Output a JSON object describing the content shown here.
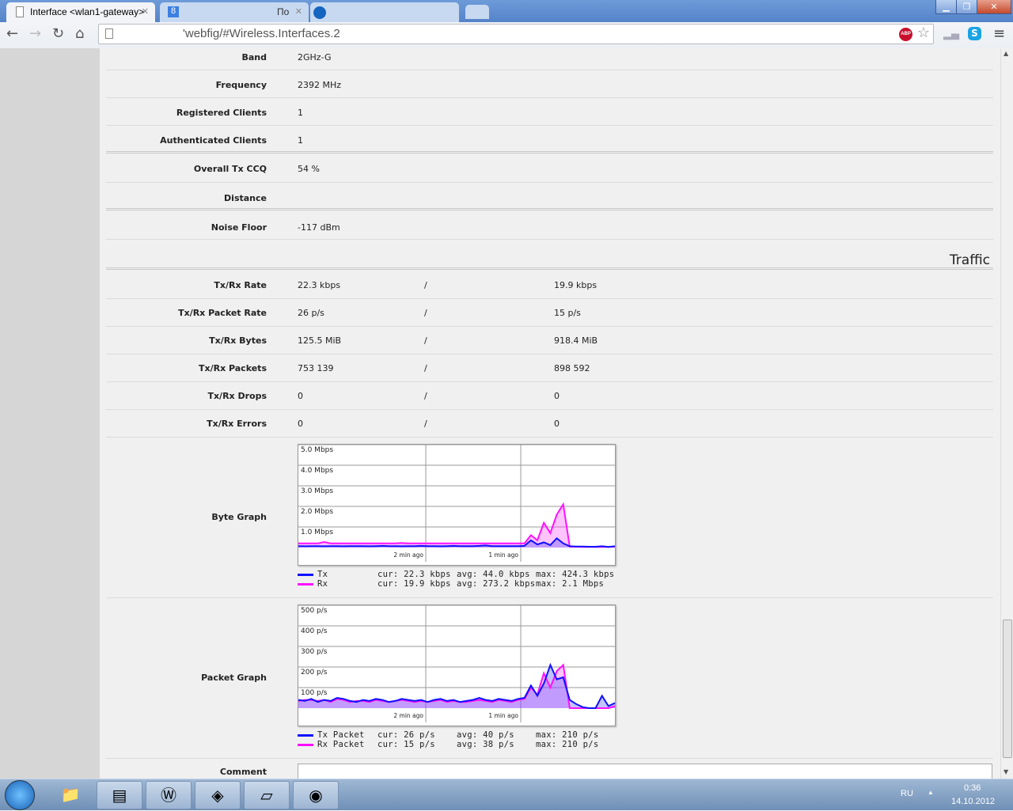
{
  "browser": {
    "tabs": [
      {
        "label": "Interface <wlan1-gateway>",
        "active": true
      },
      {
        "label": "По",
        "active": false
      },
      {
        "label": "",
        "active": false
      }
    ],
    "url": "'webfig/#Wireless.Interfaces.2",
    "abp_badge": "ABP"
  },
  "rows": [
    {
      "label": "Band",
      "value": "2GHz-G"
    },
    {
      "label": "Frequency",
      "value": "2392 MHz"
    },
    {
      "label": "Registered Clients",
      "value": "1"
    },
    {
      "label": "Authenticated Clients",
      "value": "1"
    },
    {
      "label": "Overall Tx CCQ",
      "value": "54 %"
    },
    {
      "label": "Distance",
      "value": ""
    },
    {
      "label": "Noise Floor",
      "value": "-117 dBm"
    }
  ],
  "traffic_title": "Traffic",
  "traffic_rows": [
    {
      "label": "Tx/Rx Rate",
      "tx": "22.3 kbps",
      "rx": "19.9 kbps"
    },
    {
      "label": "Tx/Rx Packet Rate",
      "tx": "26 p/s",
      "rx": "15 p/s"
    },
    {
      "label": "Tx/Rx Bytes",
      "tx": "125.5 MiB",
      "rx": "918.4 MiB"
    },
    {
      "label": "Tx/Rx Packets",
      "tx": "753 139",
      "rx": "898 592"
    },
    {
      "label": "Tx/Rx Drops",
      "tx": "0",
      "rx": "0"
    },
    {
      "label": "Tx/Rx Errors",
      "tx": "0",
      "rx": "0"
    }
  ],
  "slash": "/",
  "comment_label": "Comment",
  "chart_data": [
    {
      "type": "area",
      "title": "Byte Graph",
      "ylim": [
        0,
        5
      ],
      "yticks": [
        "1.0 Mbps",
        "2.0 Mbps",
        "3.0 Mbps",
        "4.0 Mbps",
        "5.0 Mbps"
      ],
      "xticks": [
        "2 min ago",
        "1 min ago"
      ],
      "series": [
        {
          "name": "Tx",
          "color": "#1010ff",
          "cur": "cur: 22.3 kbps",
          "avg": "avg: 44.0 kbps",
          "max": "max: 424.3 kbps",
          "values": [
            0.07,
            0.06,
            0.07,
            0.07,
            0.06,
            0.07,
            0.07,
            0.06,
            0.07,
            0.07,
            0.07,
            0.06,
            0.07,
            0.08,
            0.07,
            0.07,
            0.06,
            0.07,
            0.07,
            0.08,
            0.07,
            0.07,
            0.06,
            0.07,
            0.08,
            0.07,
            0.07,
            0.07,
            0.08,
            0.1,
            0.07,
            0.07,
            0.07,
            0.07,
            0.07,
            0.08,
            0.35,
            0.15,
            0.25,
            0.12,
            0.45,
            0.2,
            0.06,
            0.05,
            0.05,
            0.04,
            0.04,
            0.06,
            0.03,
            0.06
          ]
        },
        {
          "name": "Rx",
          "color": "#ff10ff",
          "cur": "cur: 19.9 kbps",
          "avg": "avg: 273.2 kbps",
          "max": "max: 2.1 Mbps",
          "values": [
            0.2,
            0.2,
            0.2,
            0.2,
            0.27,
            0.2,
            0.2,
            0.2,
            0.2,
            0.2,
            0.2,
            0.2,
            0.2,
            0.2,
            0.2,
            0.2,
            0.22,
            0.2,
            0.2,
            0.2,
            0.2,
            0.2,
            0.2,
            0.2,
            0.2,
            0.2,
            0.2,
            0.2,
            0.2,
            0.2,
            0.2,
            0.2,
            0.2,
            0.2,
            0.2,
            0.2,
            0.6,
            0.35,
            1.2,
            0.7,
            1.6,
            2.1,
            0.04,
            0.04,
            0.03,
            0.03,
            0.03,
            0.03,
            0.03,
            0.04
          ]
        }
      ]
    },
    {
      "type": "area",
      "title": "Packet Graph",
      "ylim": [
        0,
        500
      ],
      "yticks": [
        "100 p/s",
        "200 p/s",
        "300 p/s",
        "400 p/s",
        "500 p/s"
      ],
      "xticks": [
        "2 min ago",
        "1 min ago"
      ],
      "series": [
        {
          "name": "Tx Packet",
          "color": "#1010ff",
          "cur": "cur: 26 p/s",
          "avg": "avg: 40 p/s",
          "max": "max: 210 p/s",
          "values": [
            40,
            35,
            45,
            30,
            40,
            35,
            50,
            45,
            35,
            30,
            40,
            35,
            45,
            40,
            30,
            35,
            45,
            40,
            35,
            40,
            30,
            40,
            45,
            35,
            40,
            30,
            35,
            40,
            50,
            40,
            35,
            45,
            40,
            35,
            45,
            50,
            110,
            60,
            120,
            210,
            140,
            150,
            40,
            20,
            5,
            0,
            0,
            60,
            10,
            25
          ]
        },
        {
          "name": "Rx Packet",
          "color": "#ff10ff",
          "cur": "cur: 15 p/s",
          "avg": "avg: 38 p/s",
          "max": "max: 210 p/s",
          "values": [
            35,
            40,
            40,
            35,
            40,
            30,
            45,
            40,
            30,
            35,
            35,
            30,
            40,
            35,
            30,
            35,
            40,
            35,
            30,
            35,
            30,
            35,
            40,
            30,
            35,
            30,
            30,
            35,
            40,
            35,
            30,
            40,
            35,
            30,
            40,
            45,
            100,
            65,
            170,
            100,
            180,
            210,
            0,
            0,
            0,
            0,
            0,
            0,
            0,
            10
          ]
        }
      ]
    }
  ],
  "taskbar": {
    "lang": "RU",
    "time": "0:36",
    "date": "14.10.2012"
  }
}
